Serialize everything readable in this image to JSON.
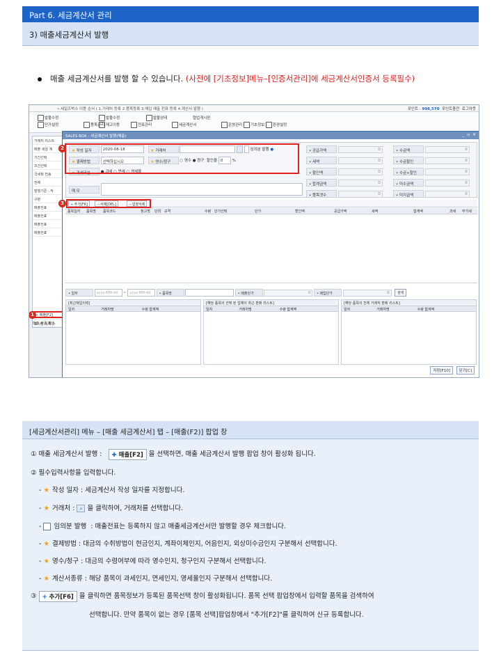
{
  "header": {
    "part": "Part 6. 세금계산서 관리",
    "section": "3) 매출세금계산서 발행"
  },
  "bullet": {
    "text": "매출 세금계산서를 발행 할 수 있습니다.",
    "note": "(사전에 [기초정보]메뉴–[인증서관리]에 세금계산서인증서 등록필수)"
  },
  "screenshot": {
    "titlebar": "• 세일즈박스 이용 순서 ( 1.거래처 등록 2.품목등록 3.매입 매출 전표 등록 4.계산서 발행 )",
    "points_label": "포인트 :",
    "points_value": "998,570",
    "point_charge": "포인트충전",
    "logout": "로그아웃",
    "ribbon": [
      "발불수정",
      "단가설정",
      "품목관리",
      "발불수정",
      "재고이동",
      "전표관리",
      "발불상태",
      "세금계산서",
      "협업게시판",
      "운영관리",
      "기초정보",
      "환경설정"
    ],
    "left_items": [
      "거래처 리스트",
      "매출 세금 계",
      "기간선택",
      "조건선택",
      "국세청 전송",
      "전체",
      "발행기준 : 작",
      "구분",
      "매출전표",
      "매출전표",
      "매출전표",
      "매출전표"
    ],
    "dialog_title": "SALES BOX - 세금계산서 발행(매출)",
    "form": {
      "date_label": "작성 일자",
      "date_value": "2020-08-18",
      "vendor_label": "거래처",
      "temp_label": "임의분 발행",
      "pay_label": "결제방법",
      "pay_value": "선택하십시오",
      "receipt_label": "영수/청구",
      "receipt_opt1": "영수",
      "receipt_opt2": "청구",
      "discount_label": "할인율",
      "discount_value": "0",
      "discount_unit": "%",
      "tax_label": "과세구분",
      "tax_opt1": "과세",
      "tax_opt2": "면세",
      "tax_opt3": "영세율",
      "memo_label": "메 모"
    },
    "sums_left": [
      "공급가액",
      "세액",
      "할인액",
      "합계금액",
      "품목갯수"
    ],
    "sums_right": [
      "수금액",
      "수금할인",
      "수금+할인",
      "미수금액",
      "미지급액"
    ],
    "buttons": {
      "add": "추가[F6]",
      "del": "삭제[DEL]",
      "alldel": "일괄삭제"
    },
    "grid_cols": [
      "품목일자",
      "품목명",
      "품목코드",
      "청고명",
      "단위",
      "규격",
      "수량",
      "단가선택",
      "단가",
      "할인액",
      "공급가액",
      "세액",
      "합계액",
      "과세",
      "부가세"
    ],
    "filter": {
      "date": "일자",
      "date_ph": "yyyy-MM-dd",
      "item": "품목명",
      "sale_price": "매출단가",
      "buy_price": "매입단가",
      "search": "검색"
    },
    "sub1_title": "[최근매입이력]",
    "sub2_title": "[해당 품목의 선택 된 업체의 최근 판매 리스트]",
    "sub3_title": "[해당 품목의 전체 거래처 판매 리스트]",
    "sub_cols": [
      "일자",
      "거래처명",
      "수량",
      "합계액"
    ],
    "footer": {
      "save": "저장[F10]",
      "close": "닫기[C]"
    },
    "left_btn": "매출[F2]",
    "bottom_tab": "매출 세금 계산",
    "left_select": "표시할 목록 수",
    "badges": [
      "1",
      "2",
      "3"
    ]
  },
  "info": {
    "title": "[세금계산서관리] 메뉴 – [매출 세금계산서] 탭 – [매출(F2)] 팝업 창",
    "l1_pre": "① 매출 세금계산서 발행 :",
    "l1_btn": "매출[F2]",
    "l1_post": "을 선택하면, 매출 세금계산서 발행 팝업 창이 활성화 됩니다.",
    "l2": "② 필수입력사항을 입력합니다.",
    "l3": "작성 일자 : 세금계산서 작성 일자를 지정합니다.",
    "l4_pre": "거래처 :",
    "l4_post": "을 클릭하여, 거래처를 선택합니다.",
    "l5_label": "임의분 발행",
    "l5_post": ": 매출전표는 등록하지 않고 매출세금계산서만 발행할 경우 체크합니다.",
    "l6": "결제방법 : 대금의 수취방법이 현금인지, 계좌이체인지, 어음인지, 외상미수금인지 구분해서 선택합니다.",
    "l7": "영수/청구 : 대금의 수령여부에 따라 영수인지, 청구인지 구분해서 선택합니다.",
    "l8": "계산서종류 : 해당 품목이 과세인지, 면세인지, 영세율인지 구분해서 선택합니다.",
    "l9_pre": "③",
    "l9_btn": "추가[F6]",
    "l9_post": "을 클릭하면 품목정보가 등록된 품목선택 창이 활성화됩니다. 품목 선택 팝업창에서 입력할 품목을 검색하여",
    "l10": "선택합니다. 만약 품목이 없는 경우 [품목 선택]팝업창에서 \"추가[F2]\"를 클릭하여 신규 등록합니다.",
    "dash": "-"
  }
}
